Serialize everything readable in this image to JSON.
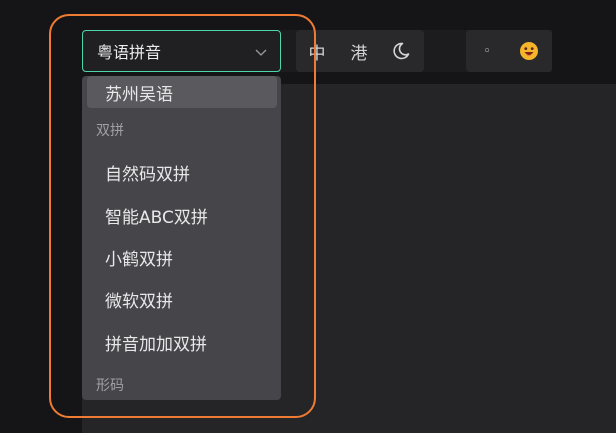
{
  "select": {
    "value": "粤语拼音",
    "chevron_icon": "chevron-down-icon"
  },
  "dropdown": {
    "items": [
      {
        "label": "苏州吴语"
      },
      {
        "group": "双拼"
      },
      {
        "label": "自然码双拼"
      },
      {
        "label": "智能ABC双拼"
      },
      {
        "label": "小鹤双拼"
      },
      {
        "label": "微软双拼"
      },
      {
        "label": "拼音加加双拼"
      },
      {
        "group": "形码"
      }
    ]
  },
  "toolbar": {
    "mode_label": "中",
    "region_label": "港",
    "theme_icon": "moon-icon",
    "punct_label": "◦",
    "emoji_icon": "emoji-icon"
  },
  "colors": {
    "accent": "#4fd6a8",
    "highlight": "#f07b32",
    "background": "#151518",
    "panel": "#252528",
    "dropdown": "#46464a"
  }
}
